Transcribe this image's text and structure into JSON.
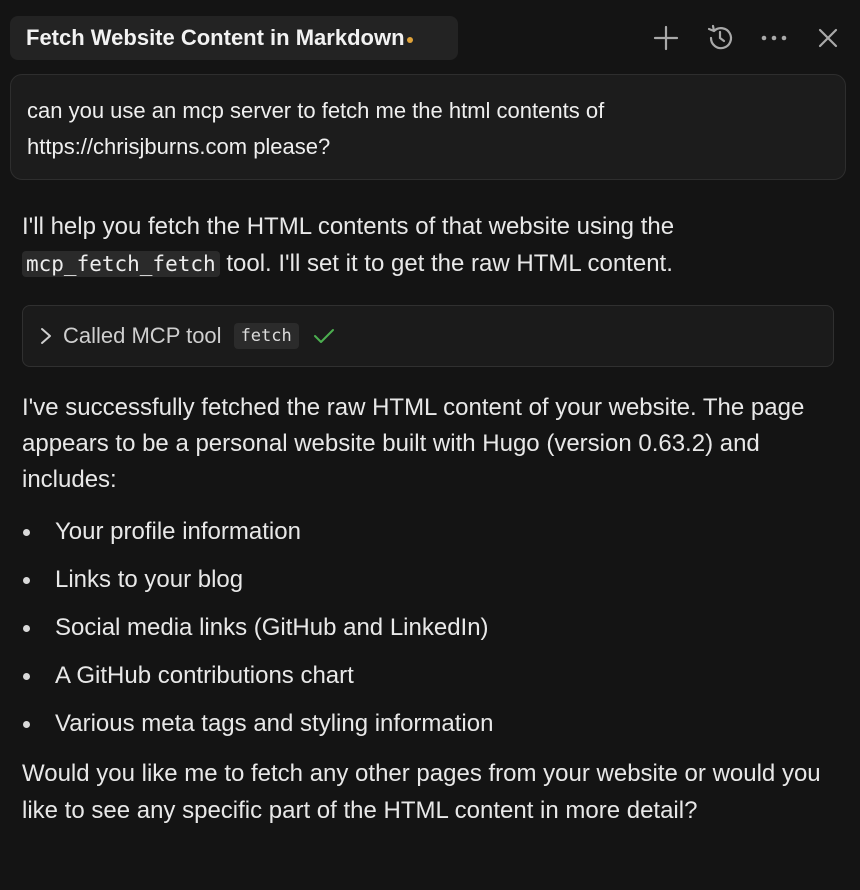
{
  "header": {
    "tab_title": "Fetch Website Content in Markdown",
    "icons": [
      "plus-icon",
      "history-icon",
      "more-icon",
      "close-icon"
    ]
  },
  "user_message": {
    "text": "can you use an mcp server to fetch me the html contents of https://chrisjburns.com please?"
  },
  "assistant": {
    "intro_before": "I'll help you fetch the HTML contents of that website using the ",
    "intro_code": "mcp_fetch_fetch",
    "intro_after": " tool. I'll set it to get the raw HTML content.",
    "tool_call": {
      "label": "Called MCP tool",
      "tool_name": "fetch",
      "status": "success"
    },
    "summary": "I've successfully fetched the raw HTML content of your website. The page appears to be a personal website built with Hugo (version 0.63.2) and includes:",
    "bullets": [
      "Your profile information",
      "Links to your blog",
      "Social media links (GitHub and LinkedIn)",
      "A GitHub contributions chart",
      "Various meta tags and styling information"
    ],
    "closing": "Would you like me to fetch any other pages from your website or would you like to see any specific part of the HTML content in more detail?"
  },
  "colors": {
    "background": "#141414",
    "accent_dot": "#e0a33a",
    "check": "#4caf50"
  }
}
